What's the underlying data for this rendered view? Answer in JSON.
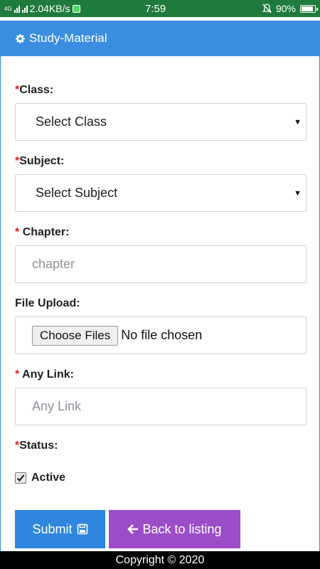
{
  "status_bar": {
    "network_speed": "2.04KB/s",
    "time": "7:59",
    "battery": "90%",
    "net_type": "4G"
  },
  "header": {
    "title": "Study-Material",
    "icon": "gear-icon"
  },
  "form": {
    "class": {
      "required": "*",
      "label": "Class:",
      "value": "Select Class"
    },
    "subject": {
      "required": "*",
      "label": "Subject:",
      "value": "Select Subject"
    },
    "chapter": {
      "required": "*",
      "label": "Chapter:",
      "placeholder": "chapter"
    },
    "file_upload": {
      "label": "File Upload:",
      "button": "Choose Files",
      "status": "No file chosen"
    },
    "any_link": {
      "required": "*",
      "label": "Any Link:",
      "placeholder": "Any Link"
    },
    "status": {
      "required": "*",
      "label": "Status:",
      "checkbox_label": "Active",
      "checked": true
    }
  },
  "buttons": {
    "submit": "Submit",
    "back": "Back to listing"
  },
  "footer": {
    "text": "Copyright © 2020"
  },
  "colors": {
    "header": "#3b8de0",
    "submit": "#2f86de",
    "back": "#9b4dc8",
    "required": "#d9232d",
    "status_bar": "#1f7a3e"
  }
}
